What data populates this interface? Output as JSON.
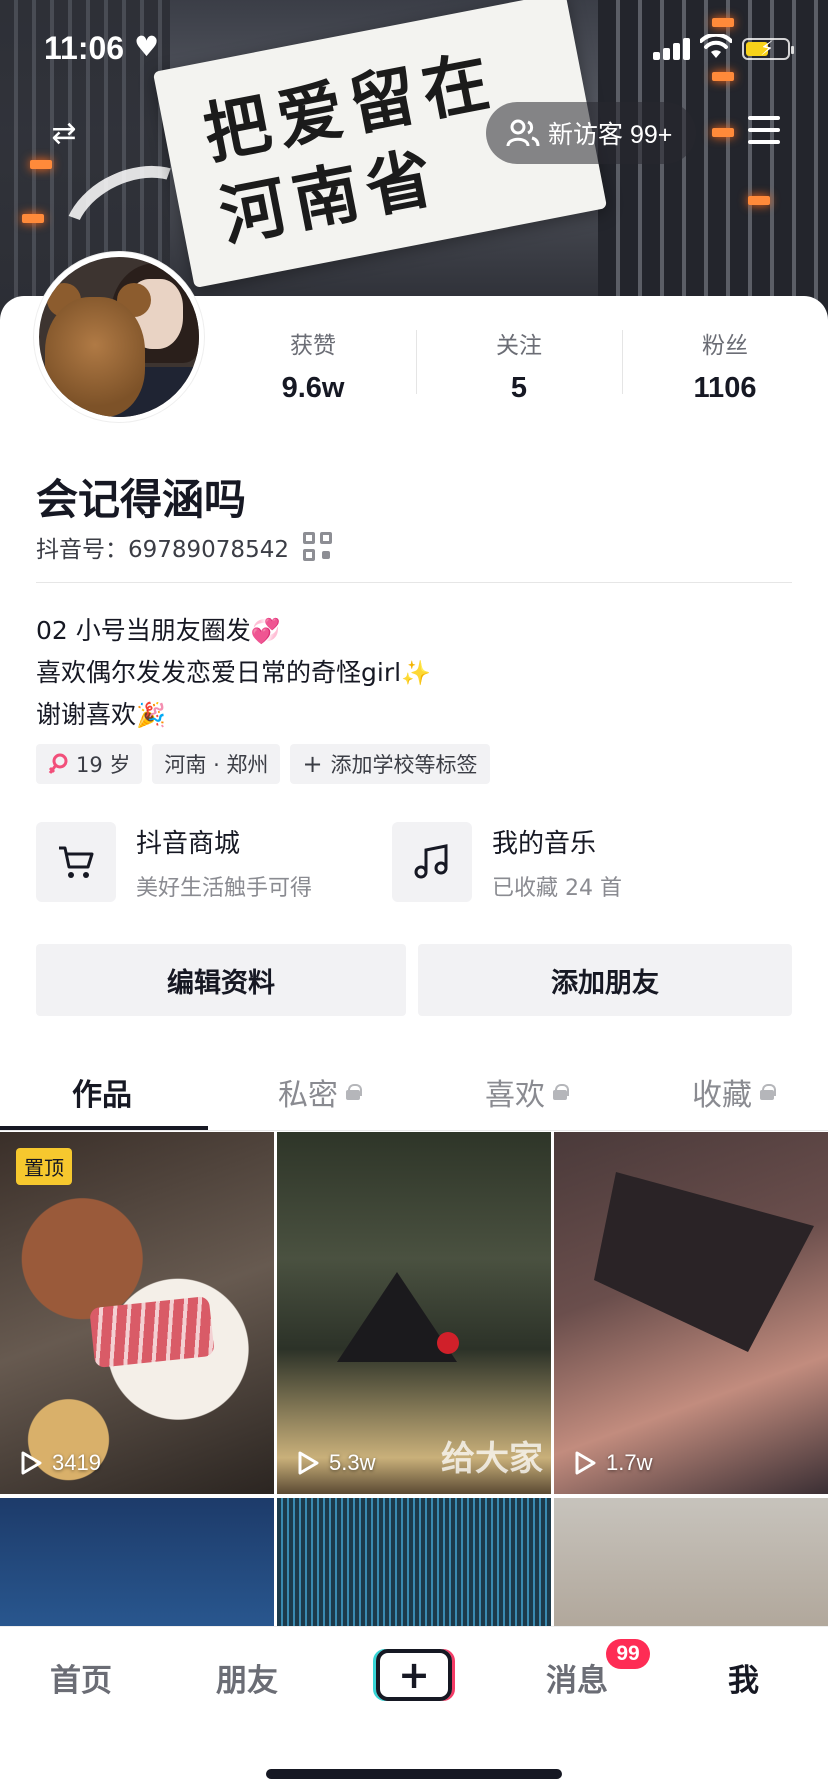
{
  "status_bar": {
    "time": "11:06",
    "heart": "♥"
  },
  "header": {
    "visitor_label": "新访客 99+",
    "swap_icon": "⇄"
  },
  "banner": {
    "flag_text": "把爱留在河南省"
  },
  "profile": {
    "username": "会记得涵吗",
    "id_label": "抖音号：69789078542",
    "stats": [
      {
        "label": "获赞",
        "value": "9.6w"
      },
      {
        "label": "关注",
        "value": "5"
      },
      {
        "label": "粉丝",
        "value": "1106"
      }
    ],
    "bio": {
      "line1": "02 小号当朋友圈发",
      "line2": "喜欢偶尔发发恋爱日常的奇怪girl",
      "line3": "谢谢喜欢",
      "emoji1": "💞",
      "emoji2": "✨",
      "emoji3": "🎉"
    },
    "tags": {
      "age": "19 岁",
      "location": "河南 · 郑州",
      "add_school": "添加学校等标签"
    }
  },
  "services": {
    "shop": {
      "title": "抖音商城",
      "subtitle": "美好生活触手可得",
      "icon": "cart-icon"
    },
    "music": {
      "title": "我的音乐",
      "subtitle": "已收藏 24 首",
      "icon": "music-note-icon"
    }
  },
  "actions": {
    "edit_profile": "编辑资料",
    "add_friend": "添加朋友"
  },
  "tabs": [
    {
      "label": "作品",
      "locked": false
    },
    {
      "label": "私密",
      "locked": true
    },
    {
      "label": "喜欢",
      "locked": true
    },
    {
      "label": "收藏",
      "locked": true
    }
  ],
  "videos": {
    "pinned_label": "置顶",
    "items": [
      {
        "views": "3419"
      },
      {
        "views": "5.3w",
        "caption": "给大家"
      },
      {
        "views": "1.7w"
      }
    ]
  },
  "nav": {
    "home": "首页",
    "friends": "朋友",
    "add": "+",
    "messages": "消息",
    "messages_badge": "99",
    "me": "我"
  },
  "colors": {
    "accent": "#fe2c55",
    "pin": "#f6c82e",
    "battery": "#f7d21a"
  }
}
